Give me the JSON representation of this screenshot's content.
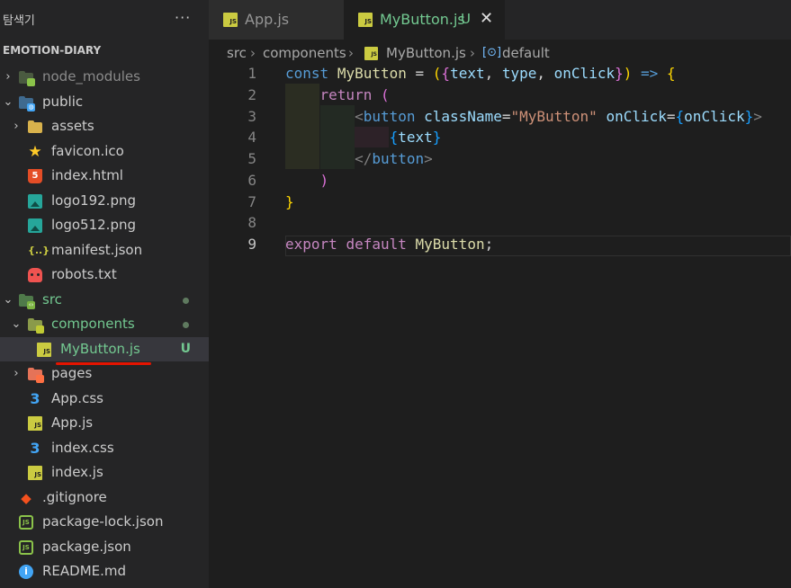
{
  "sidebar": {
    "title": "탐색기",
    "more": "···",
    "project": "EMOTION-DIARY",
    "items": [
      {
        "label": "node_modules",
        "chevron": "›",
        "color": "#8b8b8b"
      },
      {
        "label": "public",
        "chevron": "⌄",
        "color": "#cccccc"
      },
      {
        "label": "assets",
        "chevron": "›",
        "color": "#cccccc"
      },
      {
        "label": "favicon.ico",
        "color": "#cccccc"
      },
      {
        "label": "index.html",
        "color": "#cccccc"
      },
      {
        "label": "logo192.png",
        "color": "#cccccc"
      },
      {
        "label": "logo512.png",
        "color": "#cccccc"
      },
      {
        "label": "manifest.json",
        "color": "#cccccc"
      },
      {
        "label": "robots.txt",
        "color": "#cccccc"
      },
      {
        "label": "src",
        "chevron": "⌄",
        "color": "#73c991"
      },
      {
        "label": "components",
        "chevron": "⌄",
        "color": "#73c991"
      },
      {
        "label": "MyButton.js",
        "badge": "U",
        "color": "#73c991"
      },
      {
        "label": "pages",
        "chevron": "›",
        "color": "#cccccc"
      },
      {
        "label": "App.css",
        "color": "#cccccc"
      },
      {
        "label": "App.js",
        "color": "#cccccc"
      },
      {
        "label": "index.css",
        "color": "#cccccc"
      },
      {
        "label": "index.js",
        "color": "#cccccc"
      },
      {
        "label": ".gitignore",
        "color": "#cccccc"
      },
      {
        "label": "package-lock.json",
        "color": "#cccccc"
      },
      {
        "label": "package.json",
        "color": "#cccccc"
      },
      {
        "label": "README.md",
        "color": "#cccccc"
      }
    ]
  },
  "tabs": [
    {
      "label": "App.js"
    },
    {
      "label": "MyButton.js",
      "status": "U",
      "close": "✕"
    }
  ],
  "breadcrumb": {
    "parts": [
      "src",
      "components",
      "MyButton.js",
      "default"
    ],
    "separator": "›"
  },
  "code": {
    "line_numbers": [
      "1",
      "2",
      "3",
      "4",
      "5",
      "6",
      "7",
      "8",
      "9"
    ],
    "active_line": 9
  },
  "colors": {
    "accent_green": "#73c991",
    "underline_red": "#e51400",
    "js_yellow": "#cbcb41"
  },
  "icons": [
    "node-folder-icon",
    "globe-folder-icon",
    "folder-icon",
    "star-icon",
    "html5-icon",
    "image-icon",
    "json-icon",
    "robot-icon",
    "code-folder-icon",
    "components-folder-icon",
    "js-icon",
    "pages-folder-icon",
    "css-icon",
    "git-icon",
    "node-icon",
    "info-icon",
    "symbol-icon"
  ]
}
